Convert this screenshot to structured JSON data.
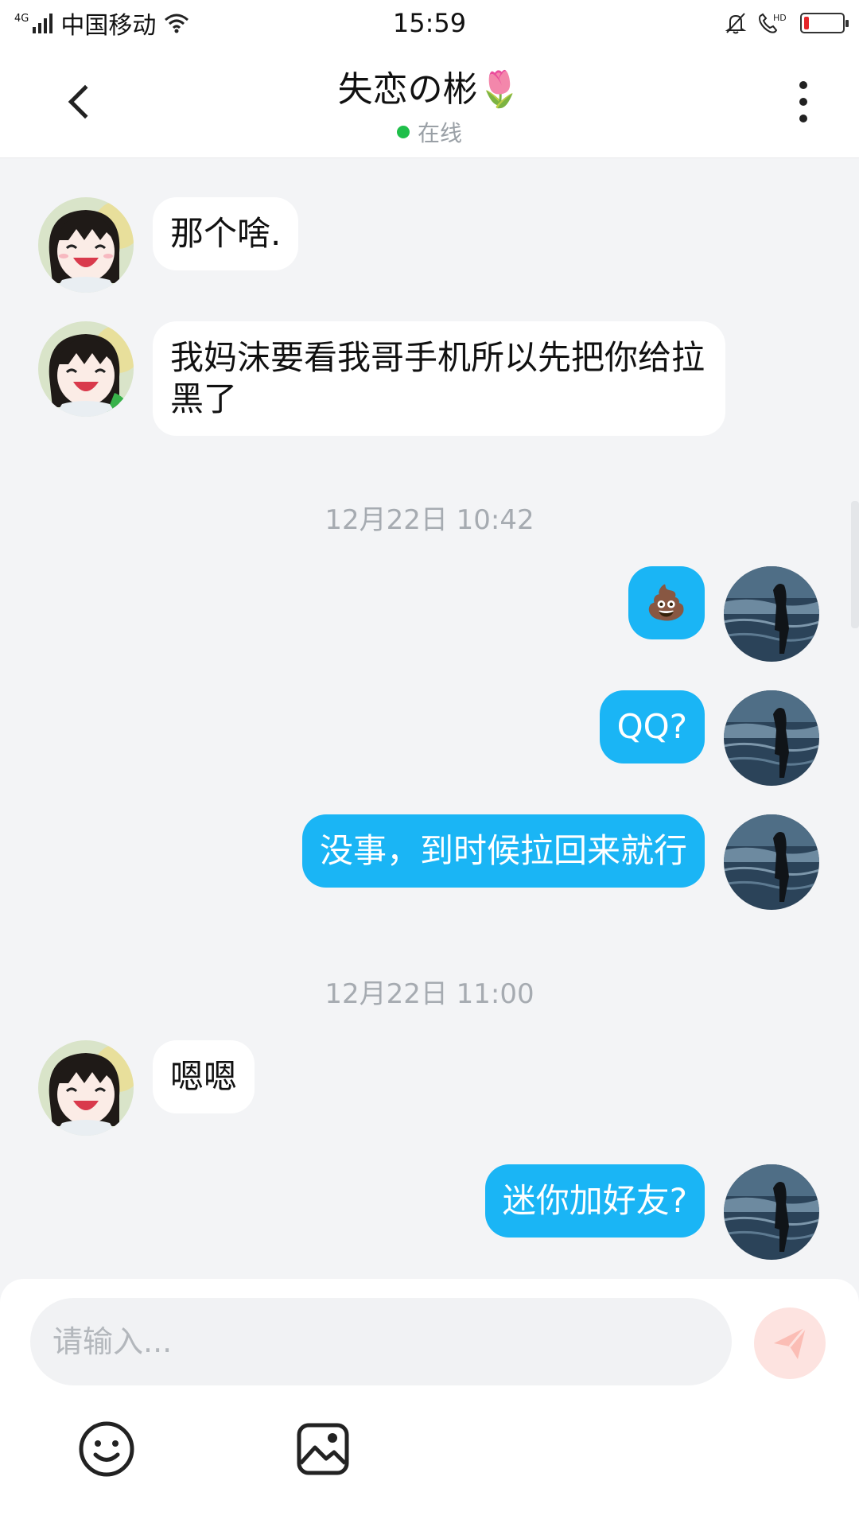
{
  "status_bar": {
    "network_type": "4G",
    "carrier": "中国移动",
    "time": "15:59",
    "call_label": "HD",
    "battery_color": "#e5262b"
  },
  "header": {
    "title": "失恋の彬🌷",
    "status": "在线",
    "status_color": "#1fbf4a"
  },
  "messages": [
    {
      "side": "in",
      "text": "那个啥."
    },
    {
      "side": "in",
      "text": "我妈沫要看我哥手机所以先把你给拉黑了"
    },
    {
      "type": "timestamp",
      "text": "12月22日 10:42"
    },
    {
      "side": "out",
      "text": "💩"
    },
    {
      "side": "out",
      "text": "QQ?"
    },
    {
      "side": "out",
      "text": "没事，到时候拉回来就行"
    },
    {
      "type": "timestamp",
      "text": "12月22日 11:00"
    },
    {
      "side": "in",
      "text": "嗯嗯"
    },
    {
      "side": "out",
      "text": "迷你加好友?"
    }
  ],
  "input": {
    "placeholder": "请输入..."
  },
  "colors": {
    "outgoing_bubble": "#1ab5f5",
    "incoming_bubble": "#ffffff",
    "background": "#f3f4f6"
  }
}
